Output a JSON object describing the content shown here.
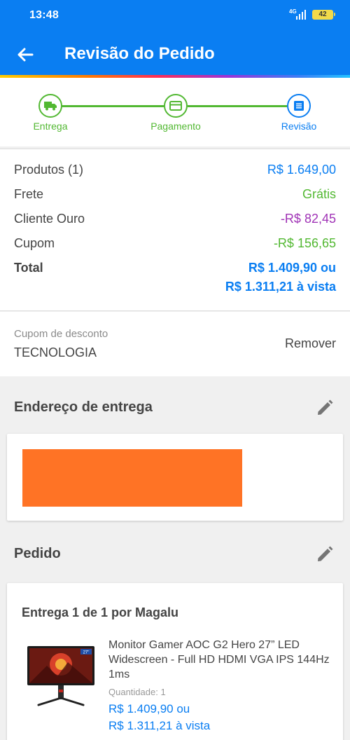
{
  "status_bar": {
    "time": "13:48",
    "network": "4G",
    "battery": "42"
  },
  "header": {
    "title": "Revisão do Pedido"
  },
  "steps": [
    {
      "label": "Entrega",
      "icon": "truck-icon"
    },
    {
      "label": "Pagamento",
      "icon": "card-icon"
    },
    {
      "label": "Revisão",
      "icon": "list-icon"
    }
  ],
  "summary": {
    "products_label": "Produtos (1)",
    "products_value": "R$ 1.649,00",
    "freight_label": "Frete",
    "freight_value": "Grátis",
    "gold_label": "Cliente Ouro",
    "gold_value": "-R$ 82,45",
    "coupon_label": "Cupom",
    "coupon_value": "-R$ 156,65",
    "total_label": "Total",
    "total_value_1": "R$ 1.409,90 ou",
    "total_value_2": "R$ 1.311,21 à vista"
  },
  "coupon": {
    "caption": "Cupom de desconto",
    "code": "TECNOLOGIA",
    "remove": "Remover"
  },
  "address": {
    "title": "Endereço de entrega"
  },
  "order": {
    "title": "Pedido",
    "delivery": "Entrega 1 de 1 por Magalu",
    "product_name": "Monitor Gamer AOC G2 Hero 27” LED Widescreen - Full HD HDMI VGA IPS 144Hz 1ms",
    "quantity": "Quantidade:  1",
    "price_installments": "R$ 1.409,90 ou",
    "price_cash": "R$ 1.311,21 à vista",
    "product_badge": "27\""
  },
  "colors": {
    "primary": "#0a7ef2",
    "success": "#52b832",
    "discount": "#a033b6",
    "redaction": "#ff7325"
  }
}
